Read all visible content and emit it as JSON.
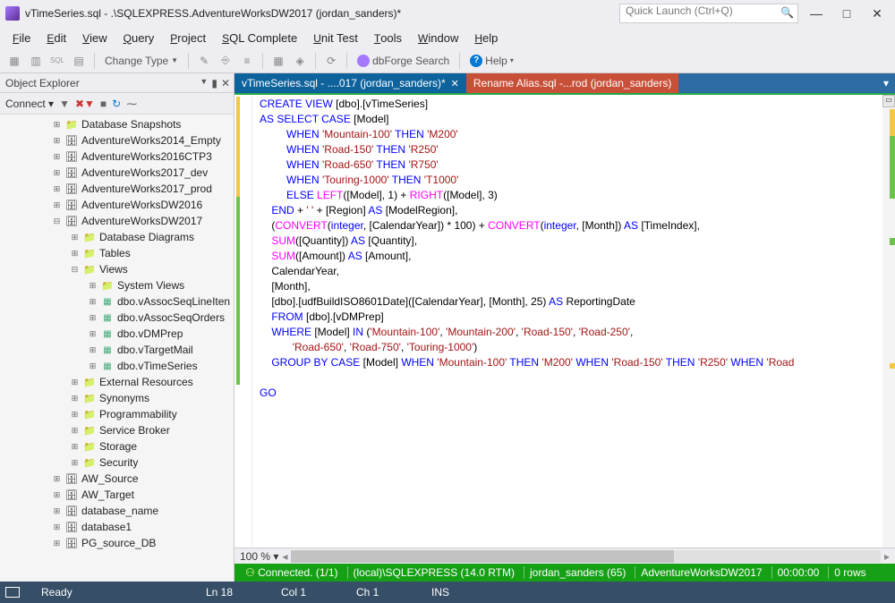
{
  "titlebar": {
    "title": "vTimeSeries.sql - .\\SQLEXPRESS.AdventureWorksDW2017 (jordan_sanders)*",
    "quick_launch_placeholder": "Quick Launch (Ctrl+Q)"
  },
  "menubar": [
    "File",
    "Edit",
    "View",
    "Query",
    "Project",
    "SQL Complete",
    "Unit Test",
    "Tools",
    "Window",
    "Help"
  ],
  "toolbar": {
    "change_type": "Change Type",
    "dbforge": "dbForge Search",
    "help": "Help"
  },
  "object_explorer": {
    "title": "Object Explorer",
    "connect": "Connect",
    "tree": [
      {
        "ind": 58,
        "exp": "+",
        "icon": "folder",
        "label": "Database Snapshots"
      },
      {
        "ind": 58,
        "exp": "+",
        "icon": "db",
        "label": "AdventureWorks2014_Empty"
      },
      {
        "ind": 58,
        "exp": "+",
        "icon": "db",
        "label": "AdventureWorks2016CTP3"
      },
      {
        "ind": 58,
        "exp": "+",
        "icon": "db",
        "label": "AdventureWorks2017_dev"
      },
      {
        "ind": 58,
        "exp": "+",
        "icon": "db",
        "label": "AdventureWorks2017_prod"
      },
      {
        "ind": 58,
        "exp": "+",
        "icon": "db",
        "label": "AdventureWorksDW2016"
      },
      {
        "ind": 58,
        "exp": "−",
        "icon": "db",
        "label": "AdventureWorksDW2017"
      },
      {
        "ind": 78,
        "exp": "+",
        "icon": "folder",
        "label": "Database Diagrams"
      },
      {
        "ind": 78,
        "exp": "+",
        "icon": "folder",
        "label": "Tables"
      },
      {
        "ind": 78,
        "exp": "−",
        "icon": "folder",
        "label": "Views"
      },
      {
        "ind": 98,
        "exp": "+",
        "icon": "folder",
        "label": "System Views"
      },
      {
        "ind": 98,
        "exp": "+",
        "icon": "view",
        "label": "dbo.vAssocSeqLineIten"
      },
      {
        "ind": 98,
        "exp": "+",
        "icon": "view",
        "label": "dbo.vAssocSeqOrders"
      },
      {
        "ind": 98,
        "exp": "+",
        "icon": "view",
        "label": "dbo.vDMPrep"
      },
      {
        "ind": 98,
        "exp": "+",
        "icon": "view",
        "label": "dbo.vTargetMail"
      },
      {
        "ind": 98,
        "exp": "+",
        "icon": "view",
        "label": "dbo.vTimeSeries"
      },
      {
        "ind": 78,
        "exp": "+",
        "icon": "folder",
        "label": "External Resources"
      },
      {
        "ind": 78,
        "exp": "+",
        "icon": "folder",
        "label": "Synonyms"
      },
      {
        "ind": 78,
        "exp": "+",
        "icon": "folder",
        "label": "Programmability"
      },
      {
        "ind": 78,
        "exp": "+",
        "icon": "folder",
        "label": "Service Broker"
      },
      {
        "ind": 78,
        "exp": "+",
        "icon": "folder",
        "label": "Storage"
      },
      {
        "ind": 78,
        "exp": "+",
        "icon": "folder",
        "label": "Security"
      },
      {
        "ind": 58,
        "exp": "+",
        "icon": "db",
        "label": "AW_Source"
      },
      {
        "ind": 58,
        "exp": "+",
        "icon": "db",
        "label": "AW_Target"
      },
      {
        "ind": 58,
        "exp": "+",
        "icon": "db",
        "label": "database_name"
      },
      {
        "ind": 58,
        "exp": "+",
        "icon": "db",
        "label": "database1"
      },
      {
        "ind": 58,
        "exp": "+",
        "icon": "db",
        "label": "PG_source_DB"
      }
    ]
  },
  "editor": {
    "tabs": [
      {
        "label": "vTimeSeries.sql - ....017 (jordan_sanders)*",
        "active": true
      },
      {
        "label": "Rename Alias.sql -...rod (jordan_sanders)",
        "active": false
      }
    ],
    "zoom": "100 %",
    "code_lines": [
      [
        [
          "kw-blue",
          "CREATE VIEW"
        ],
        [
          "",
          " [dbo].[vTimeSeries]"
        ]
      ],
      [
        [
          "kw-blue",
          "AS SELECT CASE"
        ],
        [
          "",
          " [Model]"
        ]
      ],
      [
        [
          "",
          "         "
        ],
        [
          "kw-blue",
          "WHEN "
        ],
        [
          "kw-red",
          "'Mountain-100'"
        ],
        [
          "kw-blue",
          " THEN "
        ],
        [
          "kw-red",
          "'M200'"
        ]
      ],
      [
        [
          "",
          "         "
        ],
        [
          "kw-blue",
          "WHEN "
        ],
        [
          "kw-red",
          "'Road-150'"
        ],
        [
          "kw-blue",
          " THEN "
        ],
        [
          "kw-red",
          "'R250'"
        ]
      ],
      [
        [
          "",
          "         "
        ],
        [
          "kw-blue",
          "WHEN "
        ],
        [
          "kw-red",
          "'Road-650'"
        ],
        [
          "kw-blue",
          " THEN "
        ],
        [
          "kw-red",
          "'R750'"
        ]
      ],
      [
        [
          "",
          "         "
        ],
        [
          "kw-blue",
          "WHEN "
        ],
        [
          "kw-red",
          "'Touring-1000'"
        ],
        [
          "kw-blue",
          " THEN "
        ],
        [
          "kw-red",
          "'T1000'"
        ]
      ],
      [
        [
          "",
          "         "
        ],
        [
          "kw-blue",
          "ELSE "
        ],
        [
          "kw-magenta",
          "LEFT"
        ],
        [
          "",
          "([Model], 1) + "
        ],
        [
          "kw-magenta",
          "RIGHT"
        ],
        [
          "",
          "([Model], 3)"
        ]
      ],
      [
        [
          "",
          "    "
        ],
        [
          "kw-blue",
          "END"
        ],
        [
          "",
          " + "
        ],
        [
          "kw-red",
          "' '"
        ],
        [
          "",
          " + [Region] "
        ],
        [
          "kw-blue",
          "AS"
        ],
        [
          "",
          " [ModelRegion],"
        ]
      ],
      [
        [
          "",
          "    ("
        ],
        [
          "kw-magenta",
          "CONVERT"
        ],
        [
          "",
          "("
        ],
        [
          "kw-blue",
          "integer"
        ],
        [
          "",
          ", [CalendarYear]) * 100) + "
        ],
        [
          "kw-magenta",
          "CONVERT"
        ],
        [
          "",
          "("
        ],
        [
          "kw-blue",
          "integer"
        ],
        [
          "",
          ", [Month]) "
        ],
        [
          "kw-blue",
          "AS"
        ],
        [
          "",
          " [TimeIndex],"
        ]
      ],
      [
        [
          "",
          "    "
        ],
        [
          "kw-magenta",
          "SUM"
        ],
        [
          "",
          "([Quantity]) "
        ],
        [
          "kw-blue",
          "AS"
        ],
        [
          "",
          " [Quantity],"
        ]
      ],
      [
        [
          "",
          "    "
        ],
        [
          "kw-magenta",
          "SUM"
        ],
        [
          "",
          "([Amount]) "
        ],
        [
          "kw-blue",
          "AS"
        ],
        [
          "",
          " [Amount],"
        ]
      ],
      [
        [
          "",
          "    CalendarYear,"
        ]
      ],
      [
        [
          "",
          "    [Month],"
        ]
      ],
      [
        [
          "",
          "    [dbo].[udfBuildISO8601Date]([CalendarYear], [Month], 25) "
        ],
        [
          "kw-blue",
          "AS"
        ],
        [
          "",
          " ReportingDate"
        ]
      ],
      [
        [
          "",
          "    "
        ],
        [
          "kw-blue",
          "FROM"
        ],
        [
          "",
          " [dbo].[vDMPrep]"
        ]
      ],
      [
        [
          "",
          "    "
        ],
        [
          "kw-blue",
          "WHERE"
        ],
        [
          "",
          " [Model] "
        ],
        [
          "kw-blue",
          "IN"
        ],
        [
          "",
          " ("
        ],
        [
          "kw-red",
          "'Mountain-100'"
        ],
        [
          "",
          ", "
        ],
        [
          "kw-red",
          "'Mountain-200'"
        ],
        [
          "",
          ", "
        ],
        [
          "kw-red",
          "'Road-150'"
        ],
        [
          "",
          ", "
        ],
        [
          "kw-red",
          "'Road-250'"
        ],
        [
          "",
          ","
        ]
      ],
      [
        [
          "",
          "           "
        ],
        [
          "kw-red",
          "'Road-650'"
        ],
        [
          "",
          ", "
        ],
        [
          "kw-red",
          "'Road-750'"
        ],
        [
          "",
          ", "
        ],
        [
          "kw-red",
          "'Touring-1000'"
        ],
        [
          "",
          ")"
        ]
      ],
      [
        [
          "",
          "    "
        ],
        [
          "kw-blue",
          "GROUP BY CASE"
        ],
        [
          "",
          " [Model] "
        ],
        [
          "kw-blue",
          "WHEN "
        ],
        [
          "kw-red",
          "'Mountain-100'"
        ],
        [
          "kw-blue",
          " THEN "
        ],
        [
          "kw-red",
          "'M200'"
        ],
        [
          "kw-blue",
          " WHEN "
        ],
        [
          "kw-red",
          "'Road-150'"
        ],
        [
          "kw-blue",
          " THEN "
        ],
        [
          "kw-red",
          "'R250'"
        ],
        [
          "kw-blue",
          " WHEN "
        ],
        [
          "kw-red",
          "'Road"
        ]
      ],
      [
        [
          "",
          ""
        ]
      ],
      [
        [
          "kw-blue",
          "GO"
        ]
      ]
    ],
    "conn_status": {
      "connected": "Connected. (1/1)",
      "server": "(local)\\SQLEXPRESS (14.0 RTM)",
      "user": "jordan_sanders (65)",
      "db": "AdventureWorksDW2017",
      "time": "00:00:00",
      "rows": "0 rows"
    }
  },
  "statusbar": {
    "ready": "Ready",
    "ln": "Ln 18",
    "col": "Col 1",
    "ch": "Ch 1",
    "ins": "INS"
  }
}
